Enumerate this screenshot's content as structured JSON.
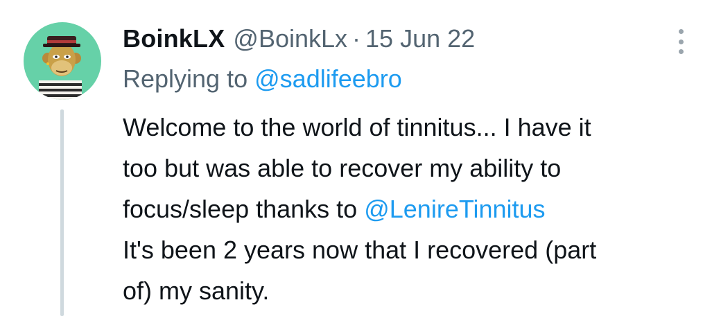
{
  "tweet": {
    "author": {
      "display_name": "BoinkLX",
      "handle": "@BoinkLx"
    },
    "separator": "·",
    "timestamp": "15 Jun 22",
    "replying": {
      "prefix": "Replying to",
      "mention": "@sadlifeebro"
    },
    "body": {
      "line1": "Welcome to the world of tinnitus... I have it",
      "line2": "too but was able to recover my ability to",
      "line3_text": "focus/sleep thanks to",
      "line3_mention": "@LenireTinnitus",
      "line4": "It's been 2 years now that I recovered (part",
      "line5": "of) my sanity."
    },
    "icons": {
      "avatar": "cartoon-ape-avatar",
      "more": "more-vertical-icon"
    },
    "colors": {
      "link": "#1d9bf0",
      "secondary_text": "#536471",
      "avatar_background": "#66d1a8",
      "thread_line": "#cfd9de"
    }
  }
}
